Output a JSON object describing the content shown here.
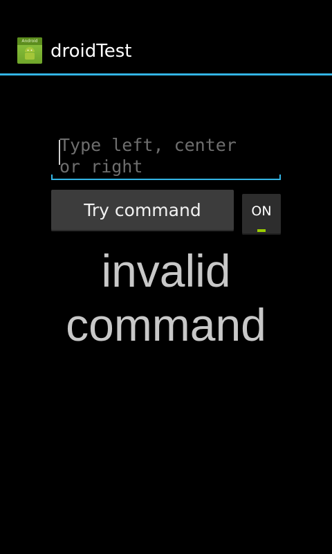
{
  "app": {
    "title": "droidTest",
    "icon": "android-robot-icon",
    "icon_ribbon_text": "Android"
  },
  "command_input": {
    "value": "",
    "placeholder": "Type left, center or right"
  },
  "buttons": {
    "try_command_label": "Try command",
    "toggle_label": "ON",
    "toggle_state": true
  },
  "result": {
    "text": "invalid command"
  },
  "colors": {
    "accent": "#33b5e5",
    "toggle_on": "#99cc00",
    "background": "#000000"
  }
}
